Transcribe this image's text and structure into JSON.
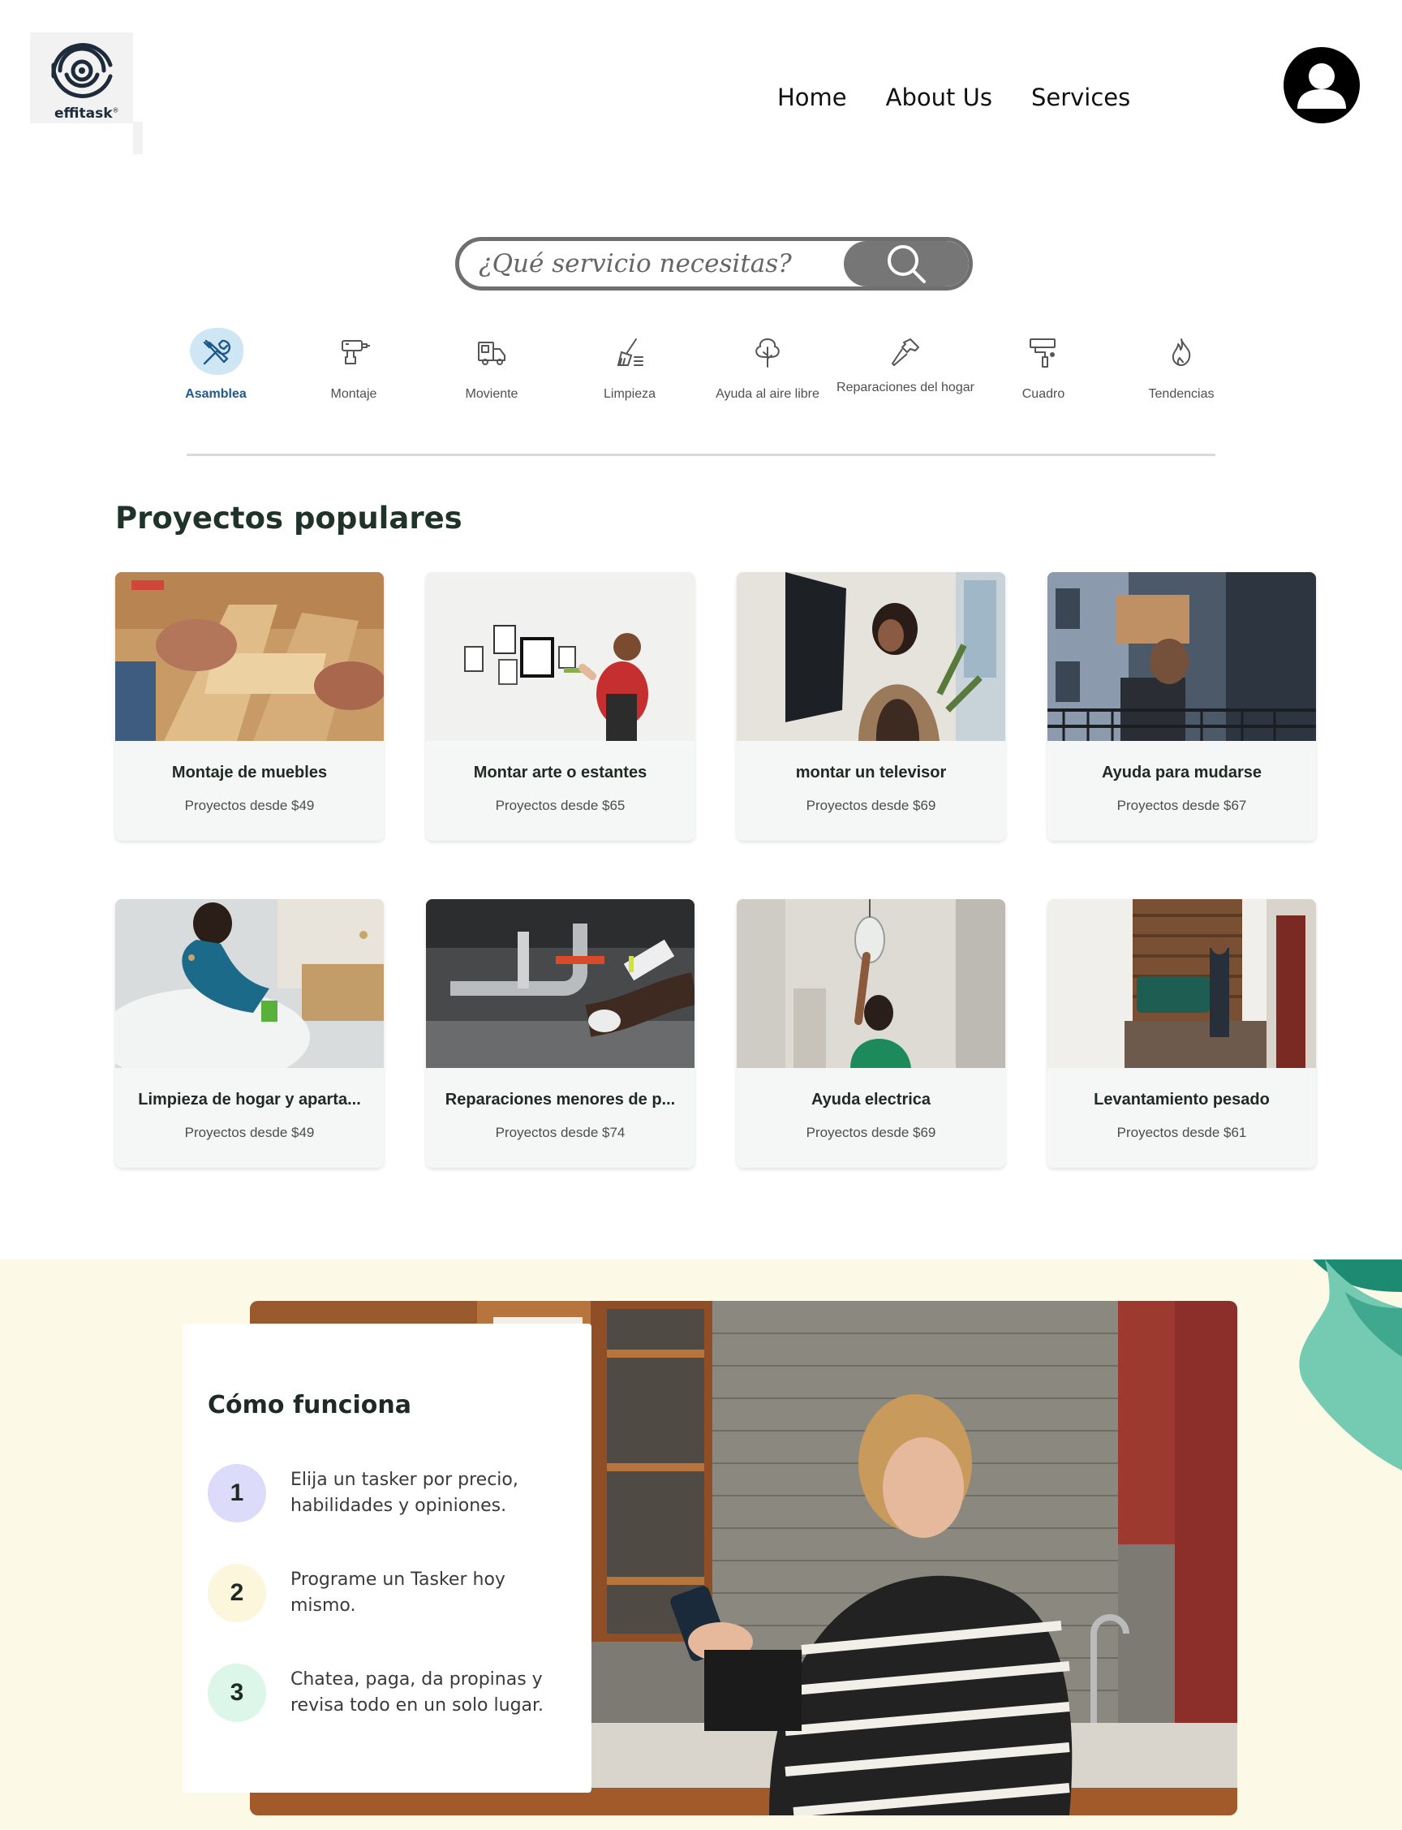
{
  "brand": {
    "name": "effitask",
    "mark": "®"
  },
  "nav": {
    "items": [
      {
        "label": "Home"
      },
      {
        "label": "About Us"
      },
      {
        "label": "Services"
      }
    ]
  },
  "search": {
    "placeholder": "¿Qué servicio necesitas?",
    "icon": "search-icon"
  },
  "categories": [
    {
      "label": "Asamblea",
      "icon": "tools-icon",
      "active": true
    },
    {
      "label": "Montaje",
      "icon": "drill-icon",
      "active": false
    },
    {
      "label": "Moviente",
      "icon": "moving-truck-icon",
      "active": false
    },
    {
      "label": "Limpieza",
      "icon": "broom-icon",
      "active": false
    },
    {
      "label": "Ayuda al aire libre",
      "icon": "tree-icon",
      "active": false
    },
    {
      "label": "Reparaciones del hogar",
      "icon": "hammer-icon",
      "active": false
    },
    {
      "label": "Cuadro",
      "icon": "paint-roller-icon",
      "active": false
    },
    {
      "label": "Tendencias",
      "icon": "flame-icon",
      "active": false
    }
  ],
  "projects": {
    "title": "Proyectos populares",
    "cards": [
      {
        "title": "Montaje de muebles",
        "price": "Proyectos desde $49"
      },
      {
        "title": "Montar arte o estantes",
        "price": "Proyectos desde $65"
      },
      {
        "title": "montar un televisor",
        "price": "Proyectos desde $69"
      },
      {
        "title": "Ayuda para mudarse",
        "price": "Proyectos desde $67"
      },
      {
        "title": "Limpieza de hogar y aparta...",
        "price": "Proyectos desde $49"
      },
      {
        "title": "Reparaciones menores de p...",
        "price": "Proyectos desde $74"
      },
      {
        "title": "Ayuda electrica",
        "price": "Proyectos desde $69"
      },
      {
        "title": "Levantamiento pesado",
        "price": "Proyectos desde $61"
      }
    ]
  },
  "how": {
    "title": "Cómo funciona",
    "steps": [
      {
        "num": "1",
        "text": "Elija un tasker por precio, habilidades y opiniones.",
        "color": "#dcdcfa"
      },
      {
        "num": "2",
        "text": "Programe un Tasker hoy mismo.",
        "color": "#fbf6dc"
      },
      {
        "num": "3",
        "text": "Chatea, paga, da propinas y revisa todo en un solo lugar.",
        "color": "#dcf6ea"
      }
    ]
  },
  "colors": {
    "accent": "#1e5a8a",
    "section_bg": "#fcf9e7",
    "teal": "#6fc7ae"
  }
}
